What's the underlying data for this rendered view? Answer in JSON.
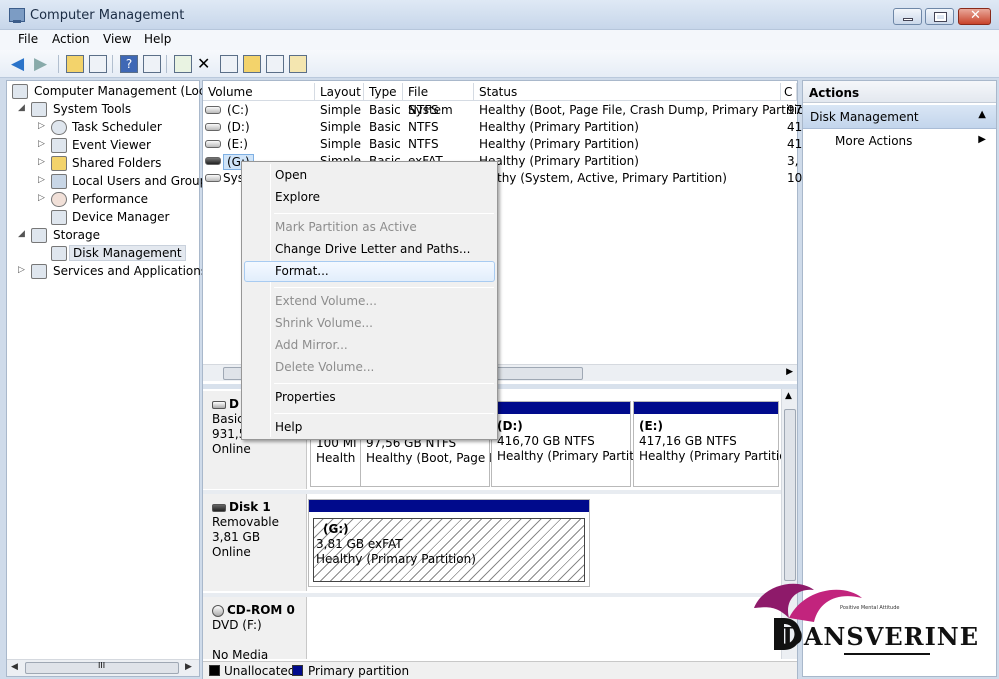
{
  "window": {
    "title": "Computer Management"
  },
  "menu": [
    "File",
    "Action",
    "View",
    "Help"
  ],
  "tree": {
    "root": "Computer Management (Local",
    "system_tools": "System Tools",
    "task_scheduler": "Task Scheduler",
    "event_viewer": "Event Viewer",
    "shared_folders": "Shared Folders",
    "local_users": "Local Users and Groups",
    "performance": "Performance",
    "device_manager": "Device Manager",
    "storage": "Storage",
    "disk_management": "Disk Management",
    "services": "Services and Applications",
    "scroll_mark": "III"
  },
  "volumes": {
    "headers": [
      "Volume",
      "Layout",
      "Type",
      "File System",
      "Status",
      "C"
    ],
    "rows": [
      {
        "volume": "(C:)",
        "layout": "Simple",
        "type": "Basic",
        "fs": "NTFS",
        "status": "Healthy (Boot, Page File, Crash Dump, Primary Partition)",
        "c": "97"
      },
      {
        "volume": "(D:)",
        "layout": "Simple",
        "type": "Basic",
        "fs": "NTFS",
        "status": "Healthy (Primary Partition)",
        "c": "41"
      },
      {
        "volume": "(E:)",
        "layout": "Simple",
        "type": "Basic",
        "fs": "NTFS",
        "status": "Healthy (Primary Partition)",
        "c": "41"
      },
      {
        "volume": "(G:)",
        "layout": "Simple",
        "type": "Basic",
        "fs": "exFAT",
        "status": "Healthy (Primary Partition)",
        "c": "3,"
      },
      {
        "volume": "Sys",
        "layout": "",
        "type": "",
        "fs": "",
        "status": "thy (System, Active, Primary Partition)",
        "c": "10"
      }
    ]
  },
  "disks": {
    "disk0": {
      "name": "D",
      "type": "Basic",
      "size": "931,51 GB",
      "state": "Online"
    },
    "disk0_parts": [
      {
        "title": "",
        "line1": "100 Mi",
        "line2": "Health"
      },
      {
        "title": "",
        "line1": "97,56 GB NTFS",
        "line2": "Healthy (Boot, Page F"
      },
      {
        "title": "(D:)",
        "line1": "416,70 GB NTFS",
        "line2": "Healthy (Primary Partitio"
      },
      {
        "title": "(E:)",
        "line1": "417,16 GB NTFS",
        "line2": "Healthy (Primary Partitio"
      }
    ],
    "disk1": {
      "name": "Disk 1",
      "type": "Removable",
      "size": "3,81 GB",
      "state": "Online"
    },
    "disk1_part": {
      "title": "(G:)",
      "line1": "3,81 GB exFAT",
      "line2": "Healthy (Primary Partition)"
    },
    "cdrom": {
      "name": "CD-ROM 0",
      "type": "DVD (F:)",
      "state": "No Media"
    }
  },
  "legend": {
    "unallocated": "Unallocated",
    "primary": "Primary partition",
    "unallocated_color": "#000000",
    "primary_color": "#000a8c"
  },
  "context_menu": {
    "open": "Open",
    "explore": "Explore",
    "mark_active": "Mark Partition as Active",
    "change_letter": "Change Drive Letter and Paths...",
    "format": "Format...",
    "extend": "Extend Volume...",
    "shrink": "Shrink Volume...",
    "add_mirror": "Add Mirror...",
    "delete": "Delete Volume...",
    "properties": "Properties",
    "help": "Help"
  },
  "actions": {
    "header": "Actions",
    "section": "Disk Management",
    "more": "More Actions"
  },
  "watermark": {
    "brand": "DANSVERINE",
    "tagline": "Positive Mental Attitude"
  }
}
